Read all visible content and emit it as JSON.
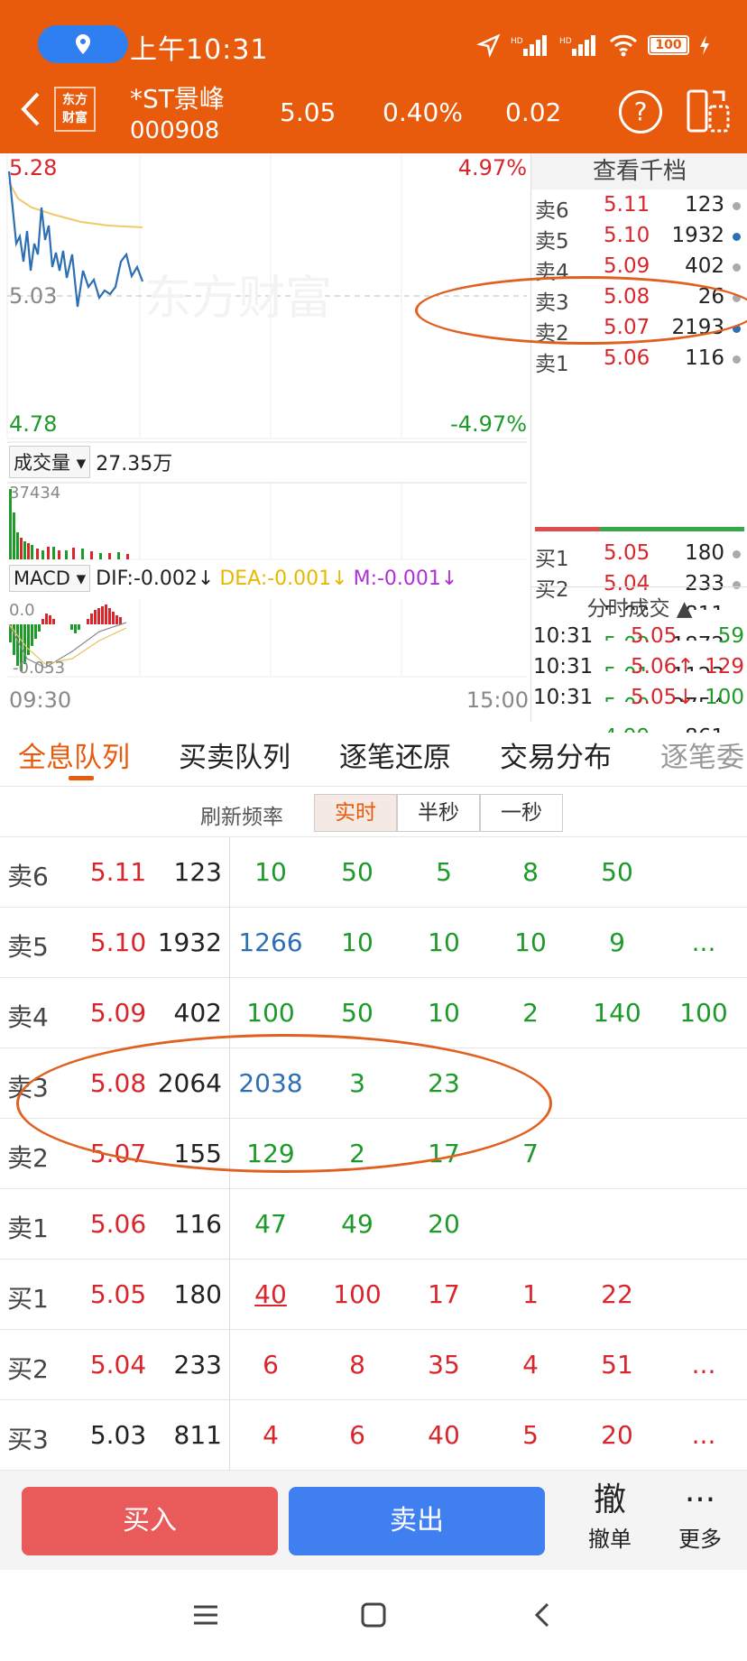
{
  "status": {
    "time": "上午10:31",
    "battery": "100"
  },
  "header": {
    "logo_line1": "东方",
    "logo_line2": "财富",
    "stock_name": "*ST景峰",
    "stock_code": "000908",
    "price": "5.05",
    "change_pct": "0.40%",
    "change": "0.02",
    "help": "?"
  },
  "chart": {
    "high": "5.28",
    "high_pct": "4.97%",
    "mid": "5.03",
    "low": "4.78",
    "low_pct": "-4.97%",
    "watermark": "东方财富",
    "volume_label": "成交量",
    "volume_value": "27.35万",
    "volume_max": "37434",
    "macd_label": "MACD",
    "dif": "DIF:-0.002↓",
    "dea": "DEA:-0.001↓",
    "m": "M:-0.001↓",
    "macd_top": "0.0",
    "macd_bottom": "-0.053",
    "time_start": "09:30",
    "time_end": "15:00"
  },
  "book": {
    "title": "查看千档",
    "asks": [
      {
        "label": "卖6",
        "price": "5.11",
        "vol": "123",
        "color": "red",
        "dot": "gray"
      },
      {
        "label": "卖5",
        "price": "5.10",
        "vol": "1932",
        "color": "red",
        "dot": "blue"
      },
      {
        "label": "卖4",
        "price": "5.09",
        "vol": "402",
        "color": "red",
        "dot": "gray"
      },
      {
        "label": "卖3",
        "price": "5.08",
        "vol": "26",
        "color": "red",
        "dot": "gray"
      },
      {
        "label": "卖2",
        "price": "5.07",
        "vol": "2193",
        "color": "red",
        "dot": "blue"
      },
      {
        "label": "卖1",
        "price": "5.06",
        "vol": "116",
        "color": "red",
        "dot": "gray"
      }
    ],
    "bids": [
      {
        "label": "买1",
        "price": "5.05",
        "vol": "180",
        "color": "red",
        "dot": "gray"
      },
      {
        "label": "买2",
        "price": "5.04",
        "vol": "233",
        "color": "red",
        "dot": "gray"
      },
      {
        "label": "买3",
        "price": "5.03",
        "vol": "811",
        "color": "black",
        "dot": "gray"
      },
      {
        "label": "买4",
        "price": "5.02",
        "vol": "1872",
        "color": "green",
        "dot": "gray"
      },
      {
        "label": "买5",
        "price": "5.01",
        "vol": "1123",
        "color": "green",
        "dot": "gray"
      },
      {
        "label": "买6",
        "price": "5.00",
        "vol": "2754",
        "color": "green",
        "dot": "orange"
      },
      {
        "label": "买7",
        "price": "4.99",
        "vol": "861",
        "color": "green",
        "dot": "gray"
      }
    ],
    "ticks_title": "分时成交 ▲",
    "ticks": [
      {
        "time": "10:31",
        "price": "5.05",
        "vol": "59",
        "pcolor": "red",
        "vcolor": "green"
      },
      {
        "time": "10:31",
        "price": "5.06↑",
        "vol": "129",
        "pcolor": "red",
        "vcolor": "red"
      },
      {
        "time": "10:31",
        "price": "5.05↓",
        "vol": "100",
        "pcolor": "red",
        "vcolor": "green"
      }
    ]
  },
  "tabs": [
    "全息队列",
    "买卖队列",
    "逐笔还原",
    "交易分布",
    "逐笔委"
  ],
  "refresh": {
    "label": "刷新频率",
    "options": [
      "实时",
      "半秒",
      "一秒"
    ]
  },
  "queue": [
    {
      "label": "卖6",
      "price": "5.11",
      "total": "123",
      "pcolor": "red",
      "cells": [
        [
          "10",
          "green"
        ],
        [
          "50",
          "green"
        ],
        [
          "5",
          "green"
        ],
        [
          "8",
          "green"
        ],
        [
          "50",
          "green"
        ]
      ]
    },
    {
      "label": "卖5",
      "price": "5.10",
      "total": "1932",
      "pcolor": "red",
      "cells": [
        [
          "1266",
          "blue"
        ],
        [
          "10",
          "green"
        ],
        [
          "10",
          "green"
        ],
        [
          "10",
          "green"
        ],
        [
          "9",
          "green"
        ],
        [
          "...",
          "green"
        ]
      ]
    },
    {
      "label": "卖4",
      "price": "5.09",
      "total": "402",
      "pcolor": "red",
      "cells": [
        [
          "100",
          "green"
        ],
        [
          "50",
          "green"
        ],
        [
          "10",
          "green"
        ],
        [
          "2",
          "green"
        ],
        [
          "140",
          "green"
        ],
        [
          "100",
          "green"
        ]
      ]
    },
    {
      "label": "卖3",
      "price": "5.08",
      "total": "2064",
      "pcolor": "red",
      "cells": [
        [
          "2038",
          "blue"
        ],
        [
          "3",
          "green"
        ],
        [
          "23",
          "green"
        ]
      ]
    },
    {
      "label": "卖2",
      "price": "5.07",
      "total": "155",
      "pcolor": "red",
      "cells": [
        [
          "129",
          "green"
        ],
        [
          "2",
          "green"
        ],
        [
          "17",
          "green"
        ],
        [
          "7",
          "green"
        ]
      ]
    },
    {
      "label": "卖1",
      "price": "5.06",
      "total": "116",
      "pcolor": "red",
      "cells": [
        [
          "47",
          "green"
        ],
        [
          "49",
          "green"
        ],
        [
          "20",
          "green"
        ]
      ]
    },
    {
      "label": "买1",
      "price": "5.05",
      "total": "180",
      "pcolor": "red",
      "cells": [
        [
          "40",
          "red"
        ],
        [
          "100",
          "red"
        ],
        [
          "17",
          "red"
        ],
        [
          "1",
          "red"
        ],
        [
          "22",
          "red"
        ]
      ]
    },
    {
      "label": "买2",
      "price": "5.04",
      "total": "233",
      "pcolor": "red",
      "cells": [
        [
          "6",
          "red"
        ],
        [
          "8",
          "red"
        ],
        [
          "35",
          "red"
        ],
        [
          "4",
          "red"
        ],
        [
          "51",
          "red"
        ],
        [
          "...",
          "red"
        ]
      ]
    },
    {
      "label": "买3",
      "price": "5.03",
      "total": "811",
      "pcolor": "black",
      "cells": [
        [
          "4",
          "red"
        ],
        [
          "6",
          "red"
        ],
        [
          "40",
          "red"
        ],
        [
          "5",
          "red"
        ],
        [
          "20",
          "red"
        ],
        [
          "...",
          "red"
        ]
      ]
    }
  ],
  "actions": {
    "buy": "买入",
    "sell": "卖出",
    "cancel_icon": "撤",
    "cancel": "撤单",
    "more_icon": "···",
    "more": "更多"
  }
}
